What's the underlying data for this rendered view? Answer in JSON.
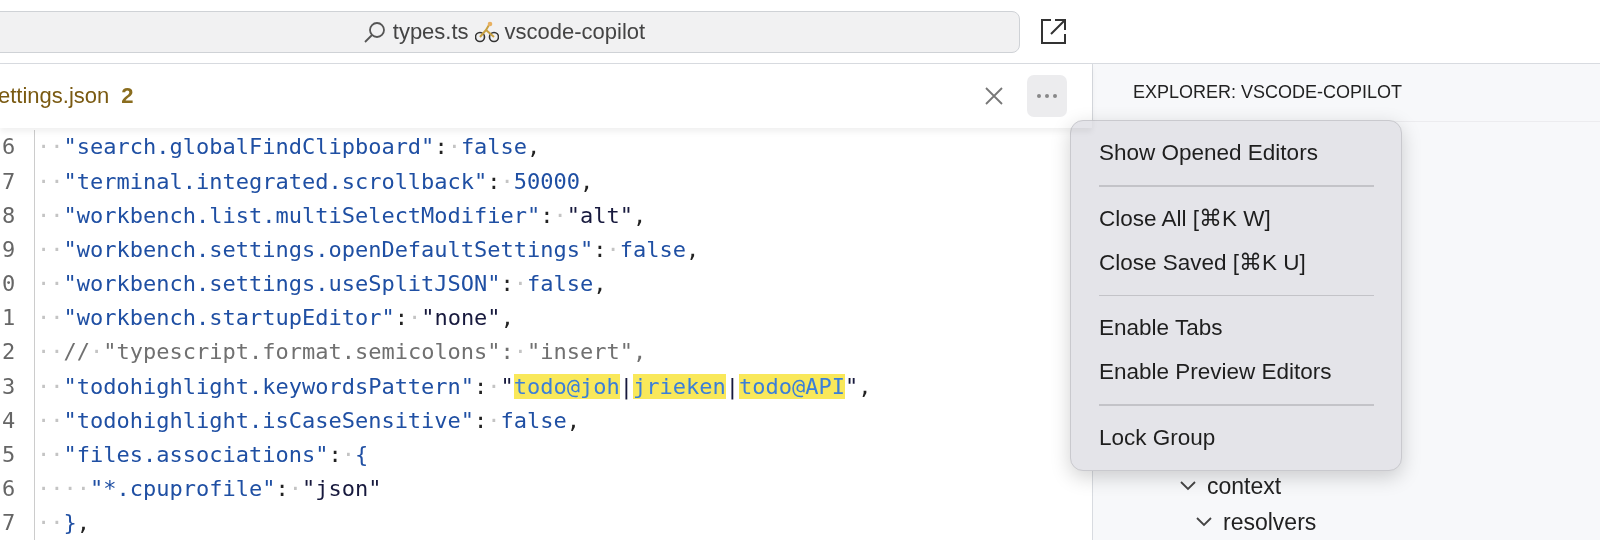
{
  "title_bar": {
    "file": "types.ts",
    "workspace": "vscode-copilot"
  },
  "editor": {
    "tab": {
      "label": "ettings.json",
      "problems": "2"
    },
    "lines": [
      {
        "number": "6",
        "tokens": [
          {
            "kind": "ws",
            "text": "··"
          },
          {
            "kind": "key",
            "text": "\"search.globalFindClipboard\""
          },
          {
            "kind": "punct",
            "text": ":"
          },
          {
            "kind": "ws",
            "text": "·"
          },
          {
            "kind": "literal",
            "text": "false"
          },
          {
            "kind": "punct",
            "text": ","
          }
        ]
      },
      {
        "number": "7",
        "tokens": [
          {
            "kind": "ws",
            "text": "··"
          },
          {
            "kind": "key",
            "text": "\"terminal.integrated.scrollback\""
          },
          {
            "kind": "punct",
            "text": ":"
          },
          {
            "kind": "ws",
            "text": "·"
          },
          {
            "kind": "literal",
            "text": "50000"
          },
          {
            "kind": "punct",
            "text": ","
          }
        ]
      },
      {
        "number": "8",
        "tokens": [
          {
            "kind": "ws",
            "text": "··"
          },
          {
            "kind": "key",
            "text": "\"workbench.list.multiSelectModifier\""
          },
          {
            "kind": "punct",
            "text": ":"
          },
          {
            "kind": "ws",
            "text": "·"
          },
          {
            "kind": "string",
            "text": "\"alt\""
          },
          {
            "kind": "punct",
            "text": ","
          }
        ]
      },
      {
        "number": "9",
        "tokens": [
          {
            "kind": "ws",
            "text": "··"
          },
          {
            "kind": "key",
            "text": "\"workbench.settings.openDefaultSettings\""
          },
          {
            "kind": "punct",
            "text": ":"
          },
          {
            "kind": "ws",
            "text": "·"
          },
          {
            "kind": "literal",
            "text": "false"
          },
          {
            "kind": "punct",
            "text": ","
          }
        ]
      },
      {
        "number": "0",
        "tokens": [
          {
            "kind": "ws",
            "text": "··"
          },
          {
            "kind": "key",
            "text": "\"workbench.settings.useSplitJSON\""
          },
          {
            "kind": "punct",
            "text": ":"
          },
          {
            "kind": "ws",
            "text": "·"
          },
          {
            "kind": "literal",
            "text": "false"
          },
          {
            "kind": "punct",
            "text": ","
          }
        ]
      },
      {
        "number": "1",
        "tokens": [
          {
            "kind": "ws",
            "text": "··"
          },
          {
            "kind": "key",
            "text": "\"workbench.startupEditor\""
          },
          {
            "kind": "punct",
            "text": ":"
          },
          {
            "kind": "ws",
            "text": "·"
          },
          {
            "kind": "string",
            "text": "\"none\""
          },
          {
            "kind": "punct",
            "text": ","
          }
        ]
      },
      {
        "number": "2",
        "tokens": [
          {
            "kind": "ws",
            "text": "··"
          },
          {
            "kind": "comment",
            "text": "//"
          },
          {
            "kind": "ws",
            "text": "·"
          },
          {
            "kind": "comment",
            "text": "\"typescript.format.semicolons\":"
          },
          {
            "kind": "ws",
            "text": "·"
          },
          {
            "kind": "comment",
            "text": "\"insert\","
          }
        ]
      },
      {
        "number": "3",
        "tokens": [
          {
            "kind": "ws",
            "text": "··"
          },
          {
            "kind": "key",
            "text": "\"todohighlight.keywordsPattern\""
          },
          {
            "kind": "punct",
            "text": ":"
          },
          {
            "kind": "ws",
            "text": "·"
          },
          {
            "kind": "string",
            "text": "\""
          },
          {
            "kind": "match",
            "text": "todo@joh"
          },
          {
            "kind": "string",
            "text": "|"
          },
          {
            "kind": "match",
            "text": "jrieken"
          },
          {
            "kind": "string",
            "text": "|"
          },
          {
            "kind": "match",
            "text": "todo@API"
          },
          {
            "kind": "string",
            "text": "\""
          },
          {
            "kind": "punct",
            "text": ","
          }
        ]
      },
      {
        "number": "4",
        "tokens": [
          {
            "kind": "ws",
            "text": "··"
          },
          {
            "kind": "key",
            "text": "\"todohighlight.isCaseSensitive\""
          },
          {
            "kind": "punct",
            "text": ":"
          },
          {
            "kind": "ws",
            "text": "·"
          },
          {
            "kind": "literal",
            "text": "false"
          },
          {
            "kind": "punct",
            "text": ","
          }
        ]
      },
      {
        "number": "5",
        "tokens": [
          {
            "kind": "ws",
            "text": "··"
          },
          {
            "kind": "key",
            "text": "\"files.associations\""
          },
          {
            "kind": "punct",
            "text": ":"
          },
          {
            "kind": "ws",
            "text": "·"
          },
          {
            "kind": "literal",
            "text": "{"
          }
        ]
      },
      {
        "number": "6",
        "tokens": [
          {
            "kind": "ws",
            "text": "····"
          },
          {
            "kind": "key",
            "text": "\"*.cpuprofile\""
          },
          {
            "kind": "punct",
            "text": ":"
          },
          {
            "kind": "ws",
            "text": "·"
          },
          {
            "kind": "string",
            "text": "\"json\""
          }
        ]
      },
      {
        "number": "7",
        "tokens": [
          {
            "kind": "ws",
            "text": "··"
          },
          {
            "kind": "literal",
            "text": "}"
          },
          {
            "kind": "punct",
            "text": ","
          }
        ]
      }
    ]
  },
  "menu": {
    "groups": [
      [
        "Show Opened Editors"
      ],
      [
        "Close All [⌘K W]",
        "Close Saved [⌘K U]"
      ],
      [
        "Enable Tabs",
        "Enable Preview Editors"
      ],
      [
        "Lock Group"
      ]
    ]
  },
  "sidebar": {
    "title": "EXPLORER: VSCODE-COPILOT",
    "tree": [
      {
        "label": "context",
        "expanded": true,
        "children": [
          {
            "label": "resolvers",
            "expanded": true
          }
        ]
      }
    ]
  }
}
